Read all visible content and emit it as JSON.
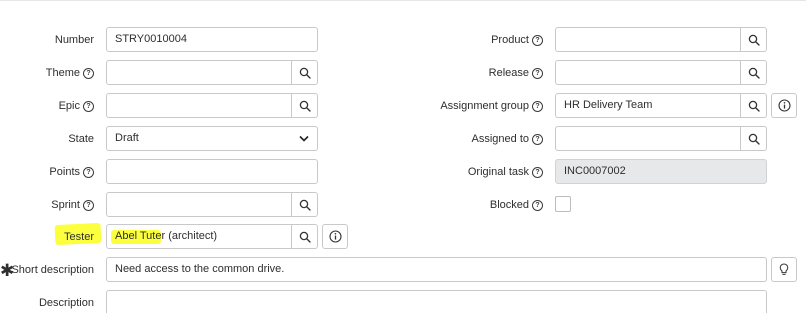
{
  "form": {
    "number": {
      "label": "Number",
      "value": "STRY0010004"
    },
    "theme": {
      "label": "Theme",
      "value": ""
    },
    "epic": {
      "label": "Epic",
      "value": ""
    },
    "state": {
      "label": "State",
      "value": "Draft"
    },
    "points": {
      "label": "Points",
      "value": ""
    },
    "sprint": {
      "label": "Sprint",
      "value": ""
    },
    "tester": {
      "label": "Tester",
      "value": "Abel Tuter (architect)"
    },
    "short_description": {
      "label": "Short description",
      "value": "Need access to the common drive."
    },
    "description": {
      "label": "Description",
      "value": ""
    },
    "product": {
      "label": "Product",
      "value": ""
    },
    "release": {
      "label": "Release",
      "value": ""
    },
    "assignment_group": {
      "label": "Assignment group",
      "value": "HR Delivery Team"
    },
    "assigned_to": {
      "label": "Assigned to",
      "value": ""
    },
    "original_task": {
      "label": "Original task",
      "value": "INC0007002"
    },
    "blocked": {
      "label": "Blocked",
      "checked": false
    }
  },
  "glyphs": {
    "help": "?",
    "required": "✱"
  },
  "colors": {
    "highlight": "#fbff3d",
    "readonly_bg": "#e6e8ea"
  }
}
